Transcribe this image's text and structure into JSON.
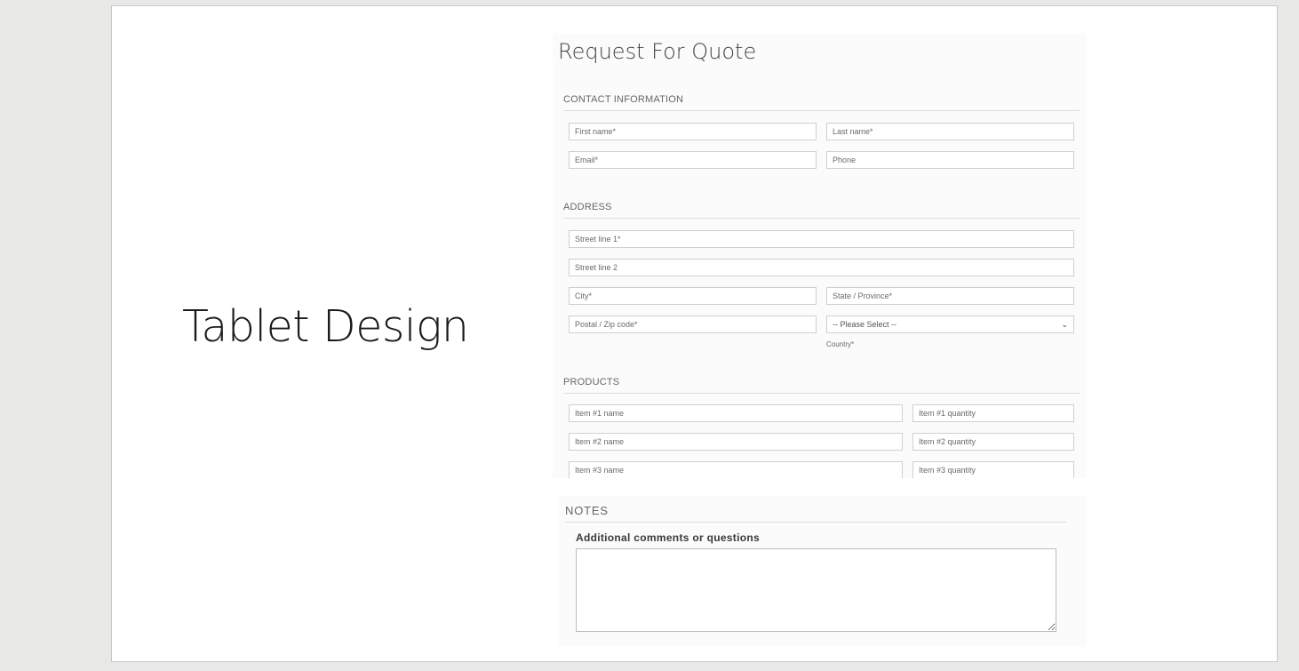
{
  "slide": {
    "title": "Tablet Design"
  },
  "form": {
    "title": "Request For Quote",
    "contact": {
      "heading": "CONTACT INFORMATION",
      "first_name": "First name*",
      "last_name": "Last name*",
      "email": "Email*",
      "phone": "Phone"
    },
    "address": {
      "heading": "ADDRESS",
      "street1": "Street line 1*",
      "street2": "Street line 2",
      "city": "City*",
      "state": "State / Province*",
      "postal": "Postal / Zip code*",
      "country_select": "-- Please Select --",
      "country_label": "Country*"
    },
    "products": {
      "heading": "PRODUCTS",
      "items": [
        {
          "name": "Item #1 name",
          "quantity": "Item #1 quantity"
        },
        {
          "name": "Item #2 name",
          "quantity": "Item #2 quantity"
        },
        {
          "name": "Item #3 name",
          "quantity": "Item #3 quantity"
        }
      ]
    }
  },
  "notes": {
    "heading": "NOTES",
    "question": "Additional comments or questions",
    "comment": ""
  },
  "icons": {
    "select_arrow": "chevron-down-icon"
  },
  "colors": {
    "page_background": "#e8e8e6",
    "slide_background": "#ffffff",
    "field_border": "#cfcfcf",
    "text": "#1a1a1a"
  }
}
